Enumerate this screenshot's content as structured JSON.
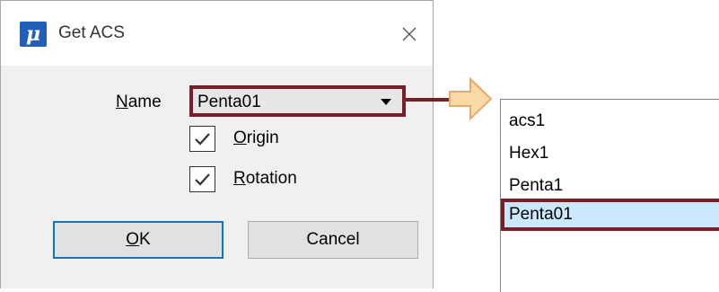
{
  "dialog": {
    "title": "Get ACS",
    "app_icon_glyph": "μ",
    "name_label_first": "N",
    "name_label_rest": "ame",
    "name_value": "Penta01",
    "origin_label_first": "O",
    "origin_label_rest": "rigin",
    "origin_checked": true,
    "rotation_label_first": "R",
    "rotation_label_rest": "otation",
    "rotation_checked": true,
    "ok_first": "O",
    "ok_rest": "K",
    "cancel_label": "Cancel"
  },
  "dropdown": {
    "items": [
      {
        "label": "acs1",
        "selected": false
      },
      {
        "label": "Hex1",
        "selected": false
      },
      {
        "label": "Penta1",
        "selected": false
      },
      {
        "label": "Penta01",
        "selected": true
      }
    ]
  },
  "colors": {
    "highlight_border": "#7a1f28",
    "arrow_fill": "#f9d9a6",
    "arrow_stroke": "#e9a96a",
    "default_button_border": "#0078d7",
    "selected_item_bg": "#cce8ff"
  },
  "icons": {
    "app": "microstation-icon",
    "close": "close-icon",
    "dropdown": "chevron-down-icon",
    "check": "checkmark-icon",
    "callout": "right-arrow-icon"
  }
}
